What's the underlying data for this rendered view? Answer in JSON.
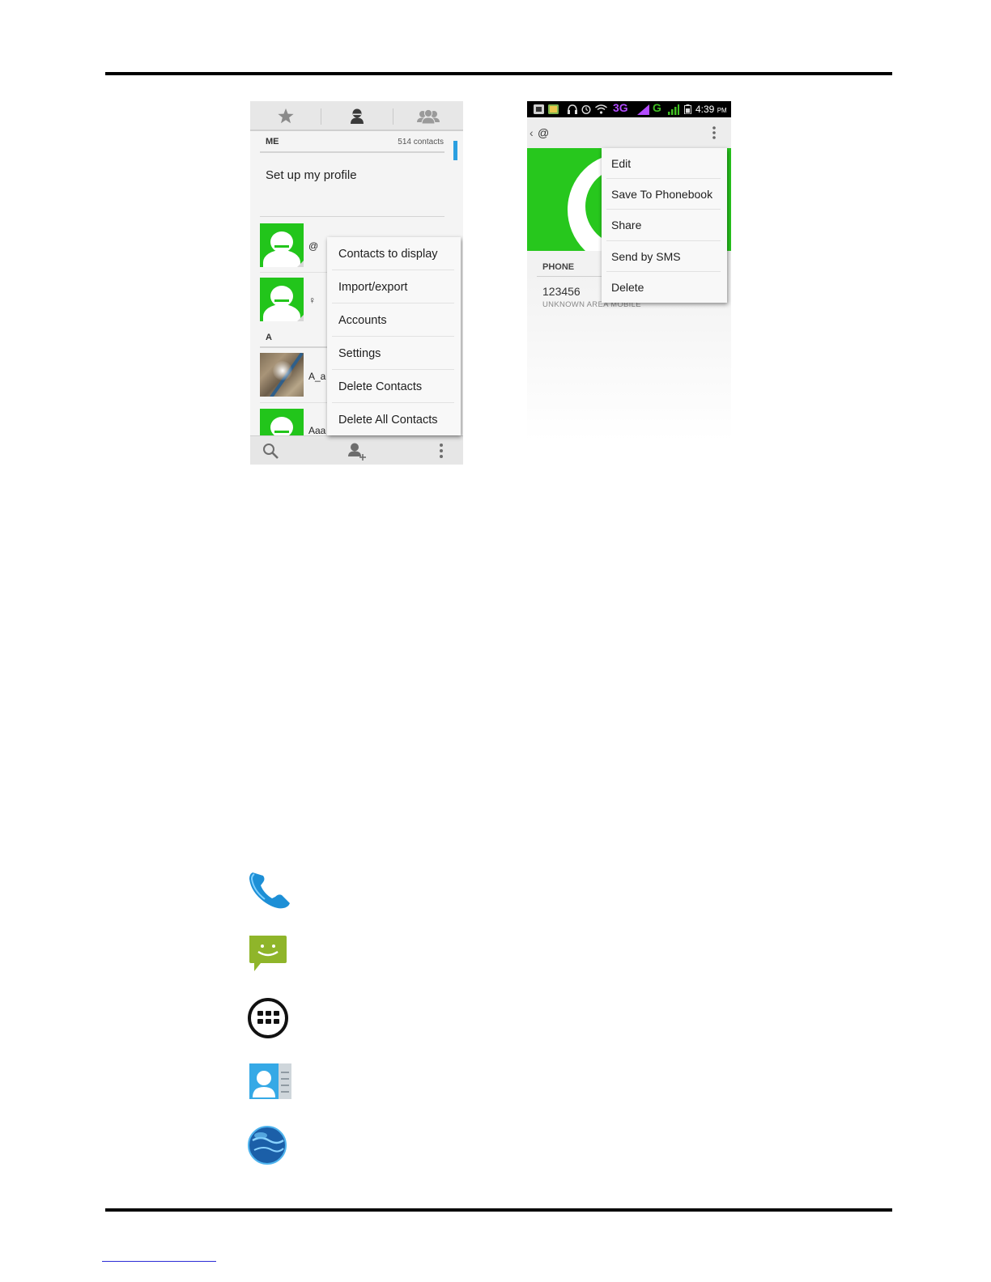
{
  "contacts_screen": {
    "tabs": [
      "favorites-tab",
      "contacts-tab",
      "groups-tab"
    ],
    "me_section": "ME",
    "contact_count": "514 contacts",
    "setup_profile": "Set up my profile",
    "section_a": "A",
    "rows": [
      {
        "name": "@"
      },
      {
        "name": "♀"
      },
      {
        "name": "A_a"
      },
      {
        "name": "Aaa"
      }
    ],
    "menu": [
      "Contacts to display",
      "Import/export",
      "Accounts",
      "Settings",
      "Delete Contacts",
      "Delete All Contacts"
    ],
    "bottom_bar": [
      "search-icon",
      "add-contact-icon",
      "overflow-menu-icon"
    ]
  },
  "detail_screen": {
    "status_bar": {
      "network_3g": "3G",
      "network_g": "G",
      "time": "4:39",
      "ampm": "PM"
    },
    "title": "@",
    "back_glyph": "‹",
    "phone_section": "PHONE",
    "phone_number": "123456",
    "phone_type": "UNKNOWN AREA MOBILE",
    "menu": [
      "Edit",
      "Save To Phonebook",
      "Share",
      "Send by SMS",
      "Delete"
    ]
  },
  "launcher_icons": [
    "phone-icon",
    "messaging-icon",
    "app-drawer-icon",
    "contacts-icon",
    "browser-icon"
  ],
  "colors": {
    "avatar_green": "#22c51b",
    "scroll_blue": "#2b9fe0",
    "status_3g": "#b34bff",
    "status_g": "#40c022"
  }
}
